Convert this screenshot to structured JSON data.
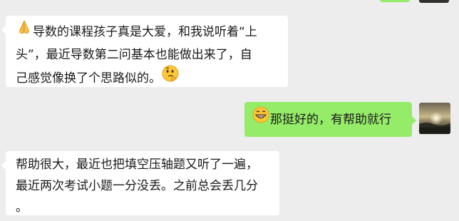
{
  "conversation": {
    "messages": [
      {
        "side": "left",
        "leading_emoji": "folded-hands",
        "trailing_emoji": "thinking-face",
        "lines": [
          "导数的课程孩子真是大爱，和我说听着“上",
          "头”，最近导数第二问基本也能做出来了，自",
          "己感觉像换了个思路似的。"
        ]
      },
      {
        "side": "right",
        "leading_emoji": "grinning-face",
        "lines": [
          "那挺好的，有帮助就行"
        ]
      },
      {
        "side": "left",
        "lines": [
          "帮助很大，最近也把填空压轴题又听了一遍，",
          "最近两次考试小题一分没丢。之前总会丢几分",
          "。"
        ]
      }
    ]
  },
  "colors": {
    "background": "#ededed",
    "incoming_bubble": "#ffffff",
    "outgoing_bubble": "#95ec69",
    "text": "#191919"
  }
}
